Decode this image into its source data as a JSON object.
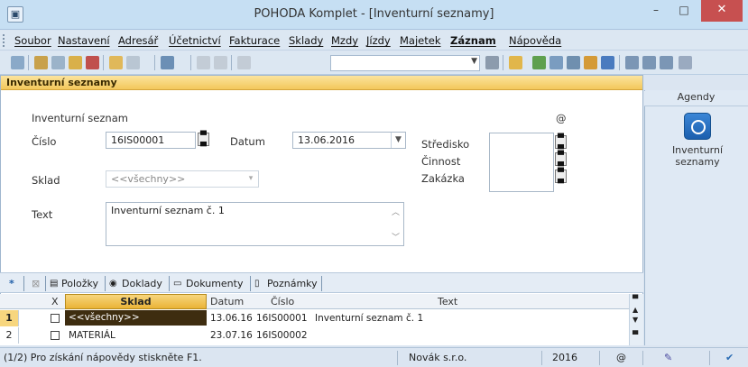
{
  "window": {
    "title": "POHODA Komplet - [Inventurní seznamy]",
    "close_glyph": "✕",
    "minimize_glyph": "–",
    "maximize_glyph": "□"
  },
  "menu": {
    "items": [
      "Soubor",
      "Nastavení",
      "Adresář",
      "Účetnictví",
      "Fakturace",
      "Sklady",
      "Mzdy",
      "Jízdy",
      "Majetek",
      "Záznam",
      "Nápověda"
    ]
  },
  "section": {
    "title": "Inventurní seznamy"
  },
  "form": {
    "group_label": "Inventurní seznam",
    "at_symbol": "@",
    "cislo_label": "Číslo",
    "cislo_value": "16IS00001",
    "datum_label": "Datum",
    "datum_value": "13.06.2016",
    "sklad_label": "Sklad",
    "sklad_value": "<<všechny>>",
    "text_label": "Text",
    "text_value": "Inventurní seznam č. 1",
    "stredisko_label": "Středisko",
    "cinnost_label": "Činnost",
    "zakazka_label": "Zakázka"
  },
  "agenda": {
    "header": "Agendy",
    "item_label": "Inventurní seznamy"
  },
  "tabs": {
    "star": "*",
    "items": [
      "Položky",
      "Doklady",
      "Dokumenty",
      "Poznámky"
    ]
  },
  "grid": {
    "headers": {
      "x": "X",
      "sklad": "Sklad",
      "datum": "Datum",
      "cislo": "Číslo",
      "text": "Text"
    },
    "rows": [
      {
        "num": "1",
        "sklad": "<<všechny>>",
        "datum": "13.06.16",
        "cislo": "16IS00001",
        "text": "Inventurní seznam č. 1"
      },
      {
        "num": "2",
        "sklad": "MATERIÁL",
        "datum": "23.07.16",
        "cislo": "16IS00002",
        "text": ""
      }
    ]
  },
  "status": {
    "hint": "(1/2) Pro získání nápovědy stiskněte F1.",
    "company": "Novák s.r.o.",
    "year": "2016",
    "at_symbol": "@"
  },
  "colors": {
    "section_accent": "#f3c75b",
    "close_button": "#c75050",
    "selected_row": "#3e2d10",
    "agenda_icon": "#1b5fae"
  }
}
